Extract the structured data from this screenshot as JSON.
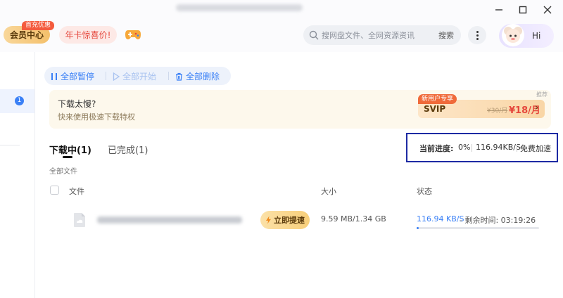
{
  "header": {
    "vip_label": "会员中心",
    "vip_tag": "首充优惠",
    "promo_label": "年卡惊喜价!",
    "search_placeholder": "搜网盘文件、全网资源资讯",
    "search_button": "搜索",
    "avatar_greeting": "Hi"
  },
  "sidebar": {
    "badge_count": "1"
  },
  "toolbar": {
    "pause_all": "全部暂停",
    "start_all": "全部开始",
    "delete_all": "全部删除"
  },
  "banner": {
    "title": "下载太慢?",
    "subtitle": "快来使用极速下载特权",
    "ad_tag": "推荐",
    "svip_tag": "新用户专享",
    "svip_name": "SVIP",
    "svip_old_price": "¥30/月",
    "svip_price": "¥18/月"
  },
  "tabs": {
    "downloading": "下载中(1)",
    "completed": "已完成(1)"
  },
  "progress": {
    "label": "当前进度:",
    "percent": "0%",
    "speed": "116.94KB/S",
    "boost": "免费加速"
  },
  "list": {
    "section_label": "全部文件",
    "columns": {
      "file": "文件",
      "size": "大小",
      "status": "状态"
    },
    "rows": [
      {
        "boost_label": "立即提速",
        "size": "9.59 MB/1.34 GB",
        "rate": "116.94 KB/S",
        "remaining": "- 剩余时间: 03:19:26",
        "progress_fraction": 0.007
      }
    ]
  },
  "colors": {
    "accent": "#3a80f6",
    "highlight_box": "#1d2aa3"
  }
}
